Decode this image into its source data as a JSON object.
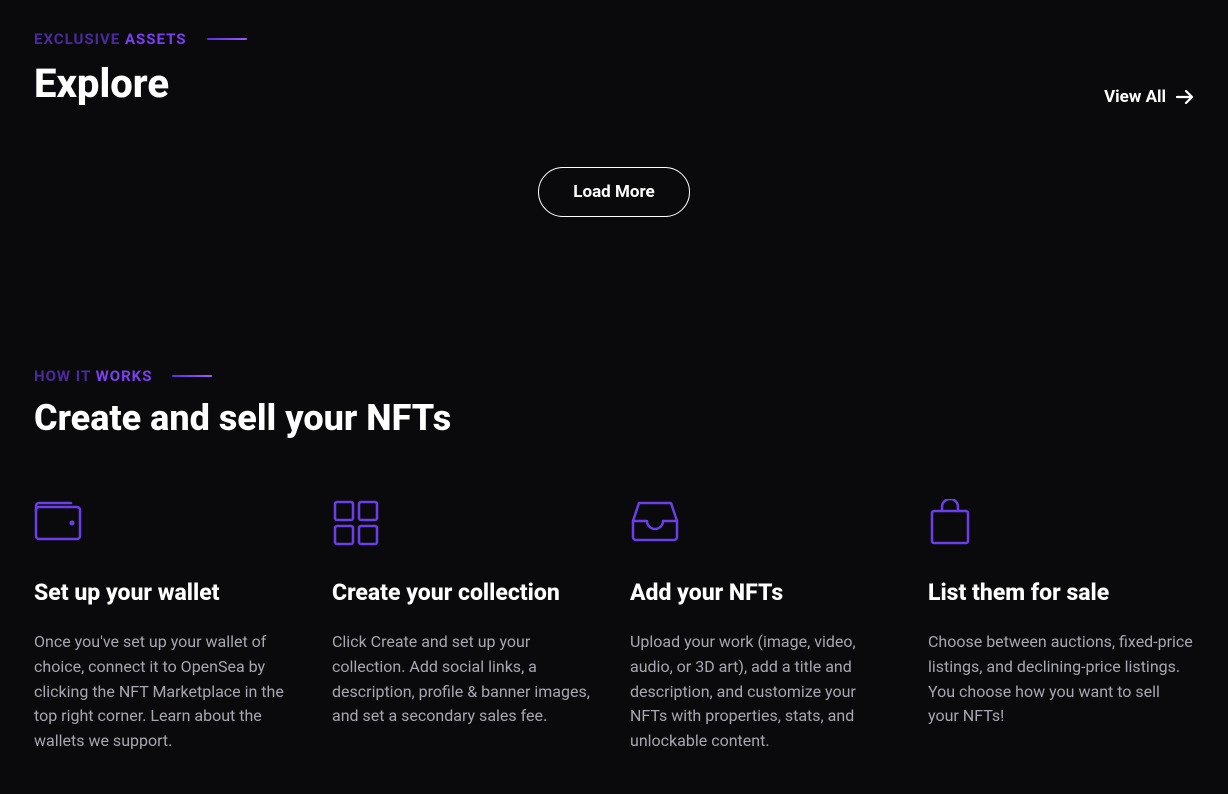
{
  "explore": {
    "eyebrow_dim": "EXCLUSIVE",
    "eyebrow_bright": "ASSETS",
    "title": "Explore",
    "view_all": "View All",
    "load_more": "Load More"
  },
  "how": {
    "eyebrow_dim": "HOW IT",
    "eyebrow_bright": "WORKS",
    "title": "Create and sell your NFTs",
    "steps": [
      {
        "title": "Set up your wallet",
        "desc": "Once you've set up your wallet of choice, connect it to OpenSea by clicking the NFT Marketplace in the top right corner. Learn about the wallets we support."
      },
      {
        "title": "Create your collection",
        "desc": "Click Create and set up your collection. Add social links, a description, profile & banner images, and set a secondary sales fee."
      },
      {
        "title": "Add your NFTs",
        "desc": "Upload your work (image, video, audio, or 3D art), add a title and description, and customize your NFTs with properties, stats, and unlockable content."
      },
      {
        "title": "List them for sale",
        "desc": "Choose between auctions, fixed-price listings, and declining-price listings. You choose how you want to sell your NFTs!"
      }
    ]
  }
}
